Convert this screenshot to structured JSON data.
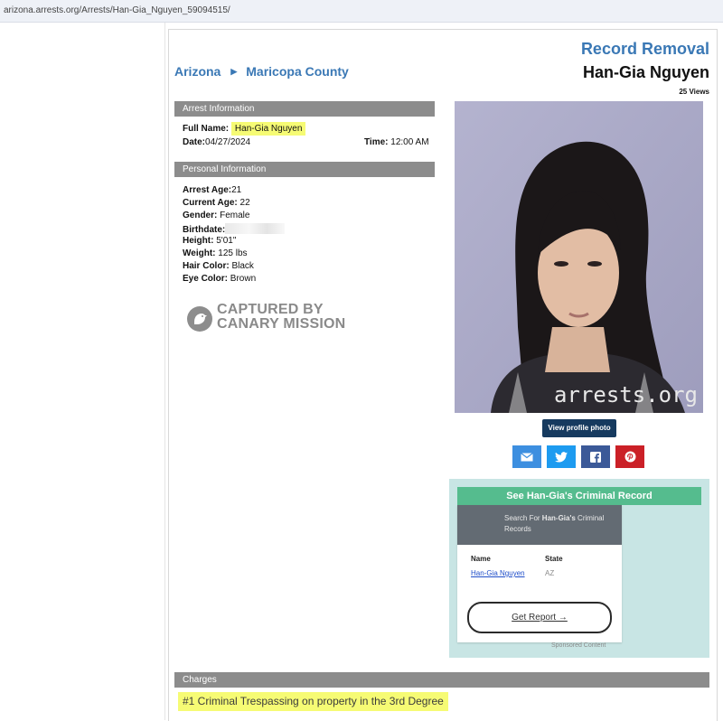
{
  "browser": {
    "url": "arizona.arrests.org/Arrests/Han-Gia_Nguyen_59094515/"
  },
  "breadcrumb": {
    "state": "Arizona",
    "separator": "▶",
    "county": "Maricopa County"
  },
  "header": {
    "record_removal": "Record Removal",
    "name": "Han-Gia Nguyen",
    "views": "25 Views"
  },
  "arrest_info": {
    "title": "Arrest Information",
    "full_name_label": "Full Name:",
    "full_name": "Han-Gia Nguyen",
    "date_label": "Date:",
    "date": "04/27/2024",
    "time_label": "Time:",
    "time": "12:00 AM"
  },
  "personal_info": {
    "title": "Personal Information",
    "arrest_age_label": "Arrest Age:",
    "arrest_age": "21",
    "current_age_label": "Current Age:",
    "current_age": "22",
    "gender_label": "Gender:",
    "gender": "Female",
    "birthdate_label": "Birthdate:",
    "height_label": "Height:",
    "height": "5'01\"",
    "weight_label": "Weight:",
    "weight": "125 lbs",
    "hair_label": "Hair Color:",
    "hair": "Black",
    "eye_label": "Eye Color:",
    "eye": "Brown"
  },
  "watermark": {
    "line1": "CAPTURED BY",
    "line2": "CANARY MISSION"
  },
  "photo": {
    "watermark": "arrests.org"
  },
  "actions": {
    "view_profile_photo": "View profile photo"
  },
  "share": [
    {
      "icon": "email-icon",
      "color": "#3d8fe0"
    },
    {
      "icon": "twitter-icon",
      "color": "#1d9bf0"
    },
    {
      "icon": "facebook-icon",
      "color": "#3b5998"
    },
    {
      "icon": "pinterest-icon",
      "color": "#cb2027"
    }
  ],
  "ad": {
    "title": "See Han-Gia's Criminal Record",
    "search_prefix": "Search For ",
    "search_name": "Han-Gia's",
    "search_suffix": " Criminal Records",
    "col_name": "Name",
    "col_state": "State",
    "result_name": "Han-Gia Nguyen",
    "result_state": "AZ",
    "get_report": "Get Report →",
    "sponsored": "Sponsored Content"
  },
  "charges": {
    "title": "Charges",
    "items": [
      "#1 Criminal Trespassing on property in the 3rd Degree"
    ]
  }
}
